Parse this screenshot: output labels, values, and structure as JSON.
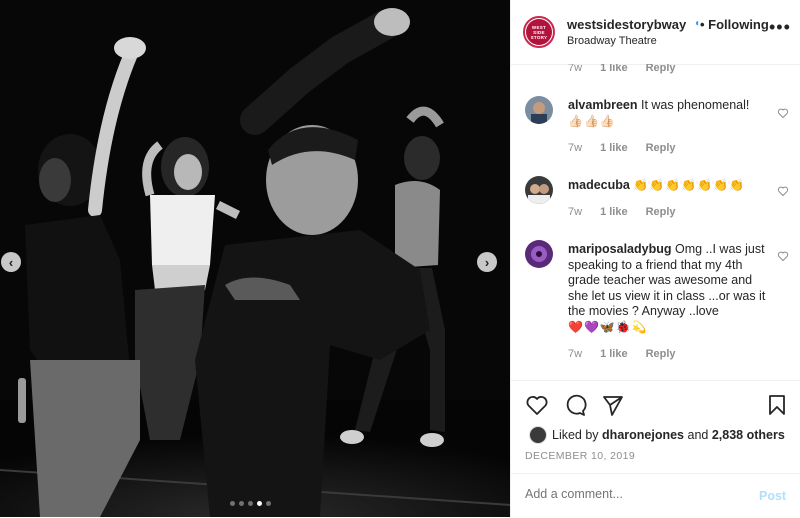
{
  "photo": {
    "left_arrow": "‹",
    "right_arrow": "›",
    "carousel_dots": [
      false,
      false,
      false,
      true,
      false
    ]
  },
  "header": {
    "username": "westsidestorybway",
    "verified": "◖",
    "following_label": "• Following",
    "location": "Broadway Theatre",
    "avatar_text": "WEST SIDE STORY",
    "more": "•••"
  },
  "comments": {
    "top_meta": {
      "age": "7w",
      "likes": "1 like",
      "reply": "Reply"
    },
    "items": [
      {
        "user": "alvambreen",
        "text": "It was phenomenal!",
        "emoji": "👍🏻👍🏻👍🏻",
        "age": "7w",
        "likes": "1 like",
        "reply": "Reply"
      },
      {
        "user": "madecuba",
        "text": "",
        "emoji": "👏👏👏👏👏👏👏",
        "age": "7w",
        "likes": "1 like",
        "reply": "Reply"
      },
      {
        "user": "mariposaladybug",
        "text": "Omg ..I was just speaking to a friend that my 4th grade teacher was awesome and she let us view it in class ...or was it the movies ? Anyway ..love",
        "emoji": "❤️💜🦋🐞💫",
        "age": "7w",
        "likes": "1 like",
        "reply": "Reply"
      }
    ]
  },
  "likes": {
    "prefix": "Liked by",
    "user": "dharonejones",
    "middle": "and",
    "count": "2,838 others"
  },
  "date": "DECEMBER 10, 2019",
  "comment_box": {
    "placeholder": "Add a comment...",
    "post_label": "Post"
  },
  "colors": {
    "brand": "#b3123d",
    "link_disabled": "#b2dffc",
    "muted": "#8e8e8e"
  }
}
